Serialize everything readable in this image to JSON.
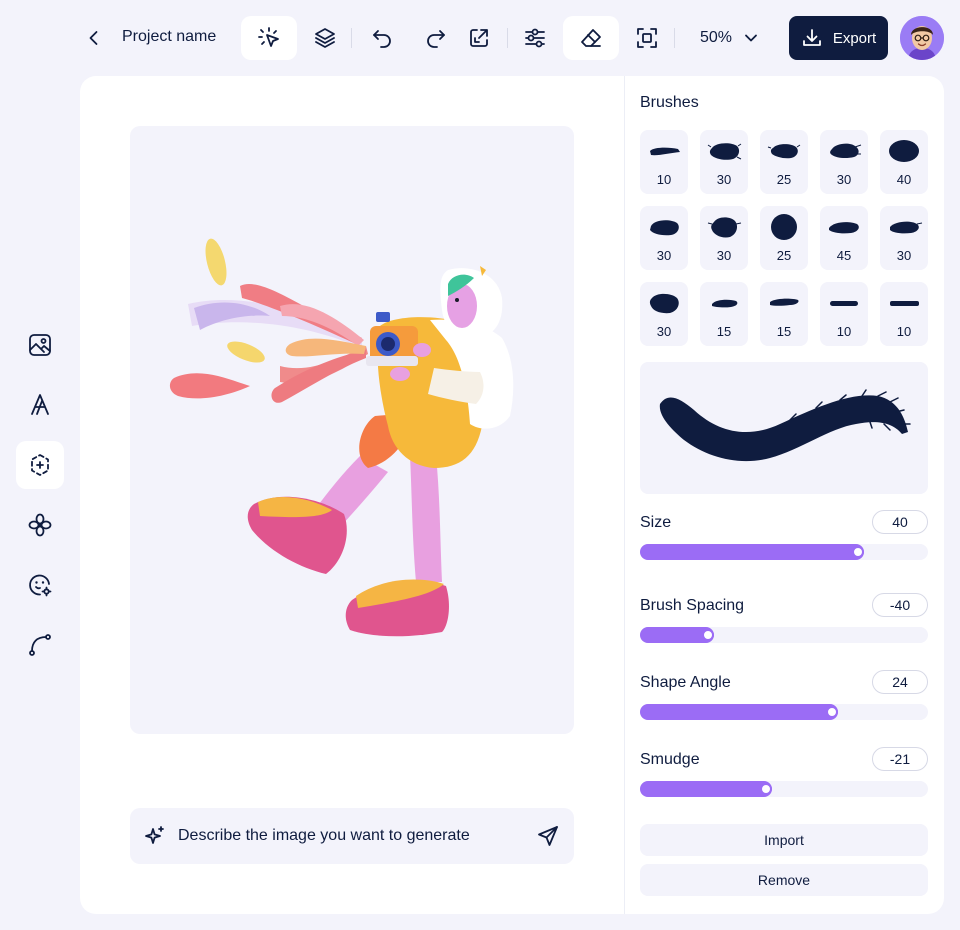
{
  "header": {
    "project_name": "Project name",
    "zoom": "50%",
    "export_label": "Export"
  },
  "tools": [
    {
      "name": "select-ai",
      "icon": "cursor-sparkle-icon",
      "active": true
    },
    {
      "name": "layers",
      "icon": "layers-icon",
      "active": false
    },
    {
      "name": "undo",
      "icon": "undo-icon",
      "active": false
    },
    {
      "name": "redo",
      "icon": "redo-icon",
      "active": false
    },
    {
      "name": "resize",
      "icon": "resize-icon",
      "active": false
    },
    {
      "name": "adjust",
      "icon": "sliders-icon",
      "active": false
    },
    {
      "name": "eraser",
      "icon": "eraser-icon",
      "active": true
    },
    {
      "name": "crop",
      "icon": "crop-frame-icon",
      "active": false
    }
  ],
  "sidebar": {
    "items": [
      {
        "name": "image",
        "icon": "image-icon",
        "active": false
      },
      {
        "name": "text",
        "icon": "text-icon",
        "active": false
      },
      {
        "name": "shapes",
        "icon": "shapes-select-icon",
        "active": true
      },
      {
        "name": "elements",
        "icon": "flower-icon",
        "active": false
      },
      {
        "name": "stickers",
        "icon": "emoji-settings-icon",
        "active": false
      },
      {
        "name": "path",
        "icon": "pen-path-icon",
        "active": false
      }
    ]
  },
  "prompt": {
    "placeholder": "Describe the image you want to generate"
  },
  "brushes": {
    "title": "Brushes",
    "items": [
      {
        "size": "10"
      },
      {
        "size": "30"
      },
      {
        "size": "25"
      },
      {
        "size": "30"
      },
      {
        "size": "40"
      },
      {
        "size": "30"
      },
      {
        "size": "30"
      },
      {
        "size": "25"
      },
      {
        "size": "45"
      },
      {
        "size": "30"
      },
      {
        "size": "30"
      },
      {
        "size": "15"
      },
      {
        "size": "15"
      },
      {
        "size": "10"
      },
      {
        "size": "10"
      }
    ]
  },
  "sliders": [
    {
      "label": "Size",
      "value": "40",
      "fraction": 0.75
    },
    {
      "label": "Brush Spacing",
      "value": "-40",
      "fraction": 0.23
    },
    {
      "label": "Shape Angle",
      "value": "24",
      "fraction": 0.66
    },
    {
      "label": "Smudge",
      "value": "-21",
      "fraction": 0.43
    }
  ],
  "actions": {
    "import_label": "Import",
    "remove_label": "Remove"
  },
  "colors": {
    "navy": "#0f1c3f",
    "accent": "#9b6cf5",
    "background": "#f3f3fb"
  }
}
